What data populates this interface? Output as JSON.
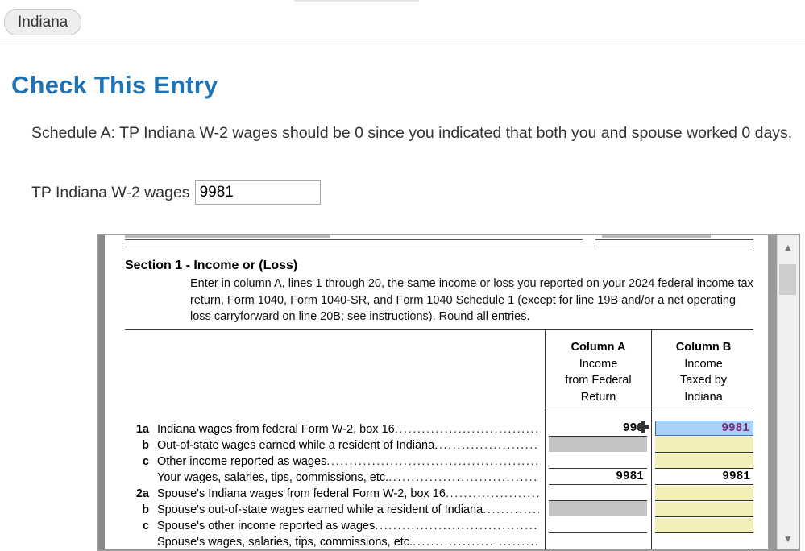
{
  "topbar": {
    "state_tab": "Indiana"
  },
  "page": {
    "title": "Check This Entry",
    "message": "Schedule A: TP Indiana W-2 wages  should be 0 since you indicated that both you and spouse worked 0 days.",
    "field_label": "TP Indiana W-2 wages",
    "field_value": "9981"
  },
  "form": {
    "section_title": "Section 1 - Income or (Loss)",
    "instructions": "Enter in column A, lines 1 through 20, the same income or loss you reported on your 2024 federal income tax return, Form 1040, Form 1040-SR, and Form 1040 Schedule 1 (except for line 19B and/or a net operating loss carryforward on line 20B; see instructions). Round all entries.",
    "column_a": {
      "title": "Column A",
      "sub1": "Income",
      "sub2": "from Federal",
      "sub3": "Return"
    },
    "column_b": {
      "title": "Column B",
      "sub1": "Income",
      "sub2": "Taxed by",
      "sub3": "Indiana"
    },
    "lines": [
      {
        "num": "1a",
        "text": "Indiana wages from federal Form W-2, box 16",
        "a": "998",
        "b": "9981"
      },
      {
        "num": "b",
        "text": "Out-of-state wages earned while a resident of Indiana",
        "a": "",
        "b": ""
      },
      {
        "num": "c",
        "text": "Other income reported as wages",
        "a": "",
        "b": ""
      },
      {
        "num": "",
        "text": "Your wages, salaries, tips, commissions, etc.",
        "a": "9981",
        "b": "9981"
      },
      {
        "num": "2a",
        "text": "Spouse's Indiana wages from federal Form W-2, box 16",
        "a": "",
        "b": ""
      },
      {
        "num": "b",
        "text": "Spouse's out-of-state wages earned while a resident of Indiana",
        "a": "",
        "b": ""
      },
      {
        "num": "c",
        "text": "Spouse's other income reported as wages",
        "a": "",
        "b": ""
      },
      {
        "num": "",
        "text": "Spouse's wages, salaries, tips, commissions, etc.",
        "a": "",
        "b": ""
      }
    ]
  },
  "scrollbar": {
    "up_icon": "chevron-up-icon",
    "down_icon": "chevron-down-icon"
  },
  "colors": {
    "title": "#1f72b3",
    "highlight_cell": "#a9d1f5",
    "entry_cell": "#f3efb8",
    "disabled_cell": "#c4c4c4"
  }
}
